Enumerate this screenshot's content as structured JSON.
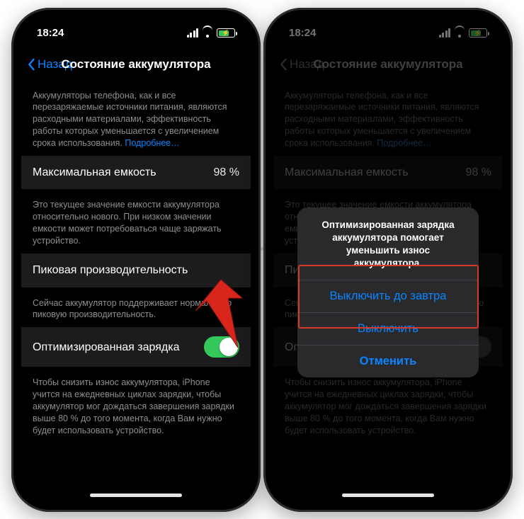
{
  "status": {
    "time": "18:24"
  },
  "nav": {
    "back": "Назад",
    "title": "Состояние аккумулятора"
  },
  "intro": {
    "text": "Аккумуляторы телефона, как и все перезаряжаемые источники питания, являются расходными материалами, эффективность работы которых уменьшается с увеличением срока использования. ",
    "link": "Подробнее…"
  },
  "capacity": {
    "label": "Максимальная емкость",
    "value": "98 %",
    "footer": "Это текущее значение емкости аккумулятора относительно нового. При низком значении емкости может потребоваться чаще заряжать устройство."
  },
  "peak": {
    "label": "Пиковая производительность",
    "footer": "Сейчас аккумулятор поддерживает нормальную пиковую производительность."
  },
  "optimized": {
    "label": "Оптимизированная зарядка",
    "footer": "Чтобы снизить износ аккумулятора, iPhone учится на ежедневных циклах зарядки, чтобы аккумулятор мог дождаться завершения зарядки выше 80 % до того момента, когда Вам нужно будет использовать устройство."
  },
  "sheet": {
    "title": "Оптимизированная зарядка аккумулятора помогает уменьшить износ аккумулятора.",
    "option1": "Выключить до завтра",
    "option2": "Выключить",
    "cancel": "Отменить"
  },
  "watermark": "ЯБЛЫК"
}
